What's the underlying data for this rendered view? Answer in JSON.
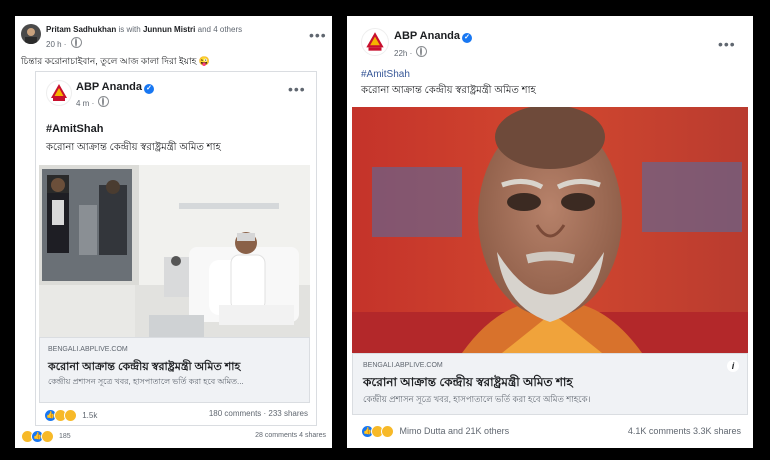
{
  "left_post": {
    "sharer_name": "Pritam Sadhukhan",
    "with_word": "is with",
    "tagged_name": "Junnun Mistri",
    "and_others": "and 4 others",
    "time": "20 h",
    "caption": "চিন্তার করোনাচাইবান, তুলে আজ কালা দিরা ইয়াহ 😜",
    "inner": {
      "page_name": "ABP Ananda",
      "time": "4 m",
      "hashtag": "#AmitShah",
      "headline": "করোনা আক্রান্ত কেন্দ্রীয় স্বরাষ্ট্রমন্ত্রী অমিত শাহ",
      "link_domain": "BENGALI.ABPLIVE.COM",
      "link_title": "করোনা আক্রান্ত কেন্দ্রীয় স্বরাষ্ট্রমন্ত্রী অমিত শাহ",
      "link_desc": "কেন্দ্রীয় প্রশাসন সূত্রে খবর, হাসপাতালে ভর্তি করা হবে অমিত...",
      "reaction_count": "1.5k",
      "comments": "180 comments",
      "shares": "233 shares"
    },
    "outer_reaction_count": "185",
    "outer_comments": "28 comments",
    "outer_shares": "4 shares"
  },
  "right_post": {
    "page_name": "ABP Ananda",
    "time": "22h",
    "hashtag": "#AmitShah",
    "headline": "করোনা আক্রান্ত কেন্দ্রীয় স্বরাষ্ট্রমন্ত্রী অমিত শাহ",
    "link_domain": "BENGALI.ABPLIVE.COM",
    "link_title": "করোনা আক্রান্ত কেন্দ্রীয় স্বরাষ্ট্রমন্ত্রী অমিত শাহ",
    "link_desc": "কেন্দ্রীয় প্রশাসন সূত্রে খবর, হাসপাতালে ভর্তি করা হবে অমিত শাহকে।",
    "reactions_label": "Mimo Dutta and 21K others",
    "comments": "4.1K comments",
    "shares": "3.3K shares"
  },
  "icons": {
    "more": "more-horizontal-icon",
    "globe": "globe-icon",
    "verified": "verified-badge-icon",
    "info": "info-icon"
  },
  "colors": {
    "facebook_blue": "#1877f2",
    "abp_red": "#c8102e",
    "abp_yellow": "#f5b400",
    "backdrop": "#000000"
  }
}
